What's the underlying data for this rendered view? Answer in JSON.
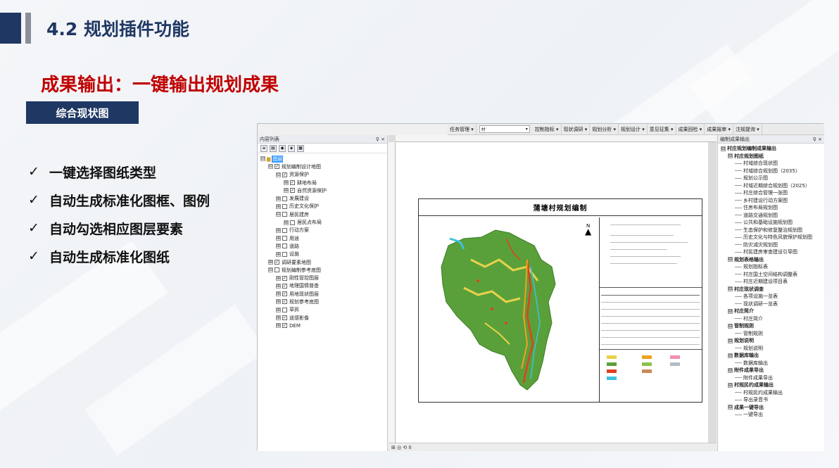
{
  "slide": {
    "title": "4.2 规划插件功能",
    "subtitle": "成果输出：一键输出规划成果",
    "badge": "综合现状图",
    "bullets": [
      {
        "check": "✓",
        "text": "一键选择图纸类型"
      },
      {
        "check": "✓",
        "text": "自动生成标准化图框、图例"
      },
      {
        "check": "✓",
        "text": "自动勾选相应图层要素"
      },
      {
        "check": "✓",
        "text": "自动生成标准化图纸"
      }
    ]
  },
  "toolbar": {
    "items": [
      "任务管理 ▾",
      "控制指标 ▾",
      "现状调研 ▾",
      "规划分析 ▾",
      "规划设计 ▾",
      "意见征集 ▾",
      "成果回检 ▾",
      "成果报审 ▾",
      "注规提询 ▾"
    ],
    "select_value": "村"
  },
  "toc": {
    "title": "内容列表",
    "controls": "♀ ×",
    "root_label": "图层",
    "nodes": [
      {
        "indent": 0,
        "exp": "⊟",
        "check": "",
        "label": "图层",
        "selected": true
      },
      {
        "indent": 1,
        "exp": "⊟",
        "check": "✓",
        "label": "规划编制设计地图"
      },
      {
        "indent": 2,
        "exp": "⊟",
        "check": "✓",
        "label": "资源保护"
      },
      {
        "indent": 3,
        "exp": "⊞",
        "check": "✓",
        "label": "耕地布局"
      },
      {
        "indent": 3,
        "exp": "⊞",
        "check": "✓",
        "label": "自然资源保护"
      },
      {
        "indent": 2,
        "exp": "⊞",
        "check": "",
        "label": "发展建设"
      },
      {
        "indent": 2,
        "exp": "⊞",
        "check": "",
        "label": "历史文化保护"
      },
      {
        "indent": 2,
        "exp": "⊟",
        "check": "",
        "label": "居民建房"
      },
      {
        "indent": 3,
        "exp": "⊞",
        "check": "",
        "label": "居民点布局"
      },
      {
        "indent": 2,
        "exp": "⊞",
        "check": "",
        "label": "行动方案"
      },
      {
        "indent": 2,
        "exp": "⊞",
        "check": "",
        "label": "用途"
      },
      {
        "indent": 2,
        "exp": "⊞",
        "check": "",
        "label": "道路"
      },
      {
        "indent": 2,
        "exp": "⊞",
        "check": "",
        "label": "设施"
      },
      {
        "indent": 1,
        "exp": "⊞",
        "check": "✓",
        "label": "调研要素地图"
      },
      {
        "indent": 1,
        "exp": "⊟",
        "check": "",
        "label": "规划编制参考底图"
      },
      {
        "indent": 2,
        "exp": "⊞",
        "check": "✓",
        "label": "刚性管控图层"
      },
      {
        "indent": 2,
        "exp": "⊞",
        "check": "✓",
        "label": "地理国情普查"
      },
      {
        "indent": 2,
        "exp": "⊞",
        "check": "✓",
        "label": "用地现状图层"
      },
      {
        "indent": 2,
        "exp": "⊞",
        "check": "✓",
        "label": "规划参考底图"
      },
      {
        "indent": 2,
        "exp": "⊞",
        "check": "",
        "label": "草拆"
      },
      {
        "indent": 2,
        "exp": "⊞",
        "check": "✓",
        "label": "遥感影像"
      },
      {
        "indent": 2,
        "exp": "⊞",
        "check": "✓",
        "label": "DEM"
      }
    ]
  },
  "layout": {
    "sheet_title": "蒲塘村规划编制",
    "north": "N"
  },
  "right_panel": {
    "title": "编制成果输出",
    "controls": "♀ ×",
    "nodes": [
      {
        "indent": 0,
        "exp": "⊟",
        "bold": true,
        "label": "村庄规划编制成果输出"
      },
      {
        "indent": 1,
        "exp": "⊟",
        "bold": true,
        "label": "村庄规划图纸"
      },
      {
        "indent": 2,
        "line": true,
        "label": "村域综合现状图"
      },
      {
        "indent": 2,
        "line": true,
        "label": "村域综合规划图（2035）"
      },
      {
        "indent": 2,
        "line": true,
        "label": "规划公示图"
      },
      {
        "indent": 2,
        "line": true,
        "label": "村域近期综合规划图（2025）"
      },
      {
        "indent": 2,
        "line": true,
        "label": "村庄综合管理一张图"
      },
      {
        "indent": 2,
        "line": true,
        "label": "乡村建设行动方案图"
      },
      {
        "indent": 2,
        "line": true,
        "label": "住房布局规划图"
      },
      {
        "indent": 2,
        "line": true,
        "label": "道路交通规划图"
      },
      {
        "indent": 2,
        "line": true,
        "label": "公共和基础设施规划图"
      },
      {
        "indent": 2,
        "line": true,
        "label": "生态保护和修复整治规划图"
      },
      {
        "indent": 2,
        "line": true,
        "label": "历史文化与特色风貌保护规划图"
      },
      {
        "indent": 2,
        "line": true,
        "label": "防灾减灾规划图"
      },
      {
        "indent": 2,
        "line": true,
        "label": "村民建房审查建设引导图"
      },
      {
        "indent": 1,
        "exp": "⊟",
        "bold": true,
        "label": "规划表格输出"
      },
      {
        "indent": 2,
        "line": true,
        "label": "规划指标表"
      },
      {
        "indent": 2,
        "line": true,
        "label": "村庄国土空间结构调整表"
      },
      {
        "indent": 2,
        "line": true,
        "label": "村庄近期建设项目表"
      },
      {
        "indent": 1,
        "exp": "⊟",
        "bold": true,
        "label": "村庄现状调查"
      },
      {
        "indent": 2,
        "line": true,
        "label": "各项设施一览表"
      },
      {
        "indent": 2,
        "line": true,
        "label": "现状调研一览表"
      },
      {
        "indent": 1,
        "exp": "⊟",
        "bold": true,
        "label": "村庄简介"
      },
      {
        "indent": 2,
        "line": true,
        "label": "村庄简介"
      },
      {
        "indent": 1,
        "exp": "⊟",
        "bold": true,
        "label": "管制规则"
      },
      {
        "indent": 2,
        "line": true,
        "label": "管制规则"
      },
      {
        "indent": 1,
        "exp": "⊟",
        "bold": true,
        "label": "规划说明"
      },
      {
        "indent": 2,
        "line": true,
        "label": "规划说明"
      },
      {
        "indent": 1,
        "exp": "⊟",
        "bold": true,
        "label": "数据库输出"
      },
      {
        "indent": 2,
        "line": true,
        "label": "数据库输出"
      },
      {
        "indent": 1,
        "exp": "⊟",
        "bold": true,
        "label": "附件成果导出"
      },
      {
        "indent": 2,
        "line": true,
        "label": "附件成果导出"
      },
      {
        "indent": 1,
        "exp": "⊟",
        "bold": true,
        "label": "村规民约成果输出"
      },
      {
        "indent": 2,
        "line": true,
        "label": "村规民约成果输出"
      },
      {
        "indent": 2,
        "line": true,
        "label": "导出录音书"
      },
      {
        "indent": 1,
        "exp": "⊟",
        "bold": true,
        "label": "成果一键导出"
      },
      {
        "indent": 2,
        "line": true,
        "label": "一键导出"
      }
    ]
  },
  "status": {
    "page_nav": "⊞ ◎ ⟲ II"
  },
  "colors": {
    "navy": "#1f3763",
    "red": "#c00000",
    "selected": "#3399ff"
  }
}
